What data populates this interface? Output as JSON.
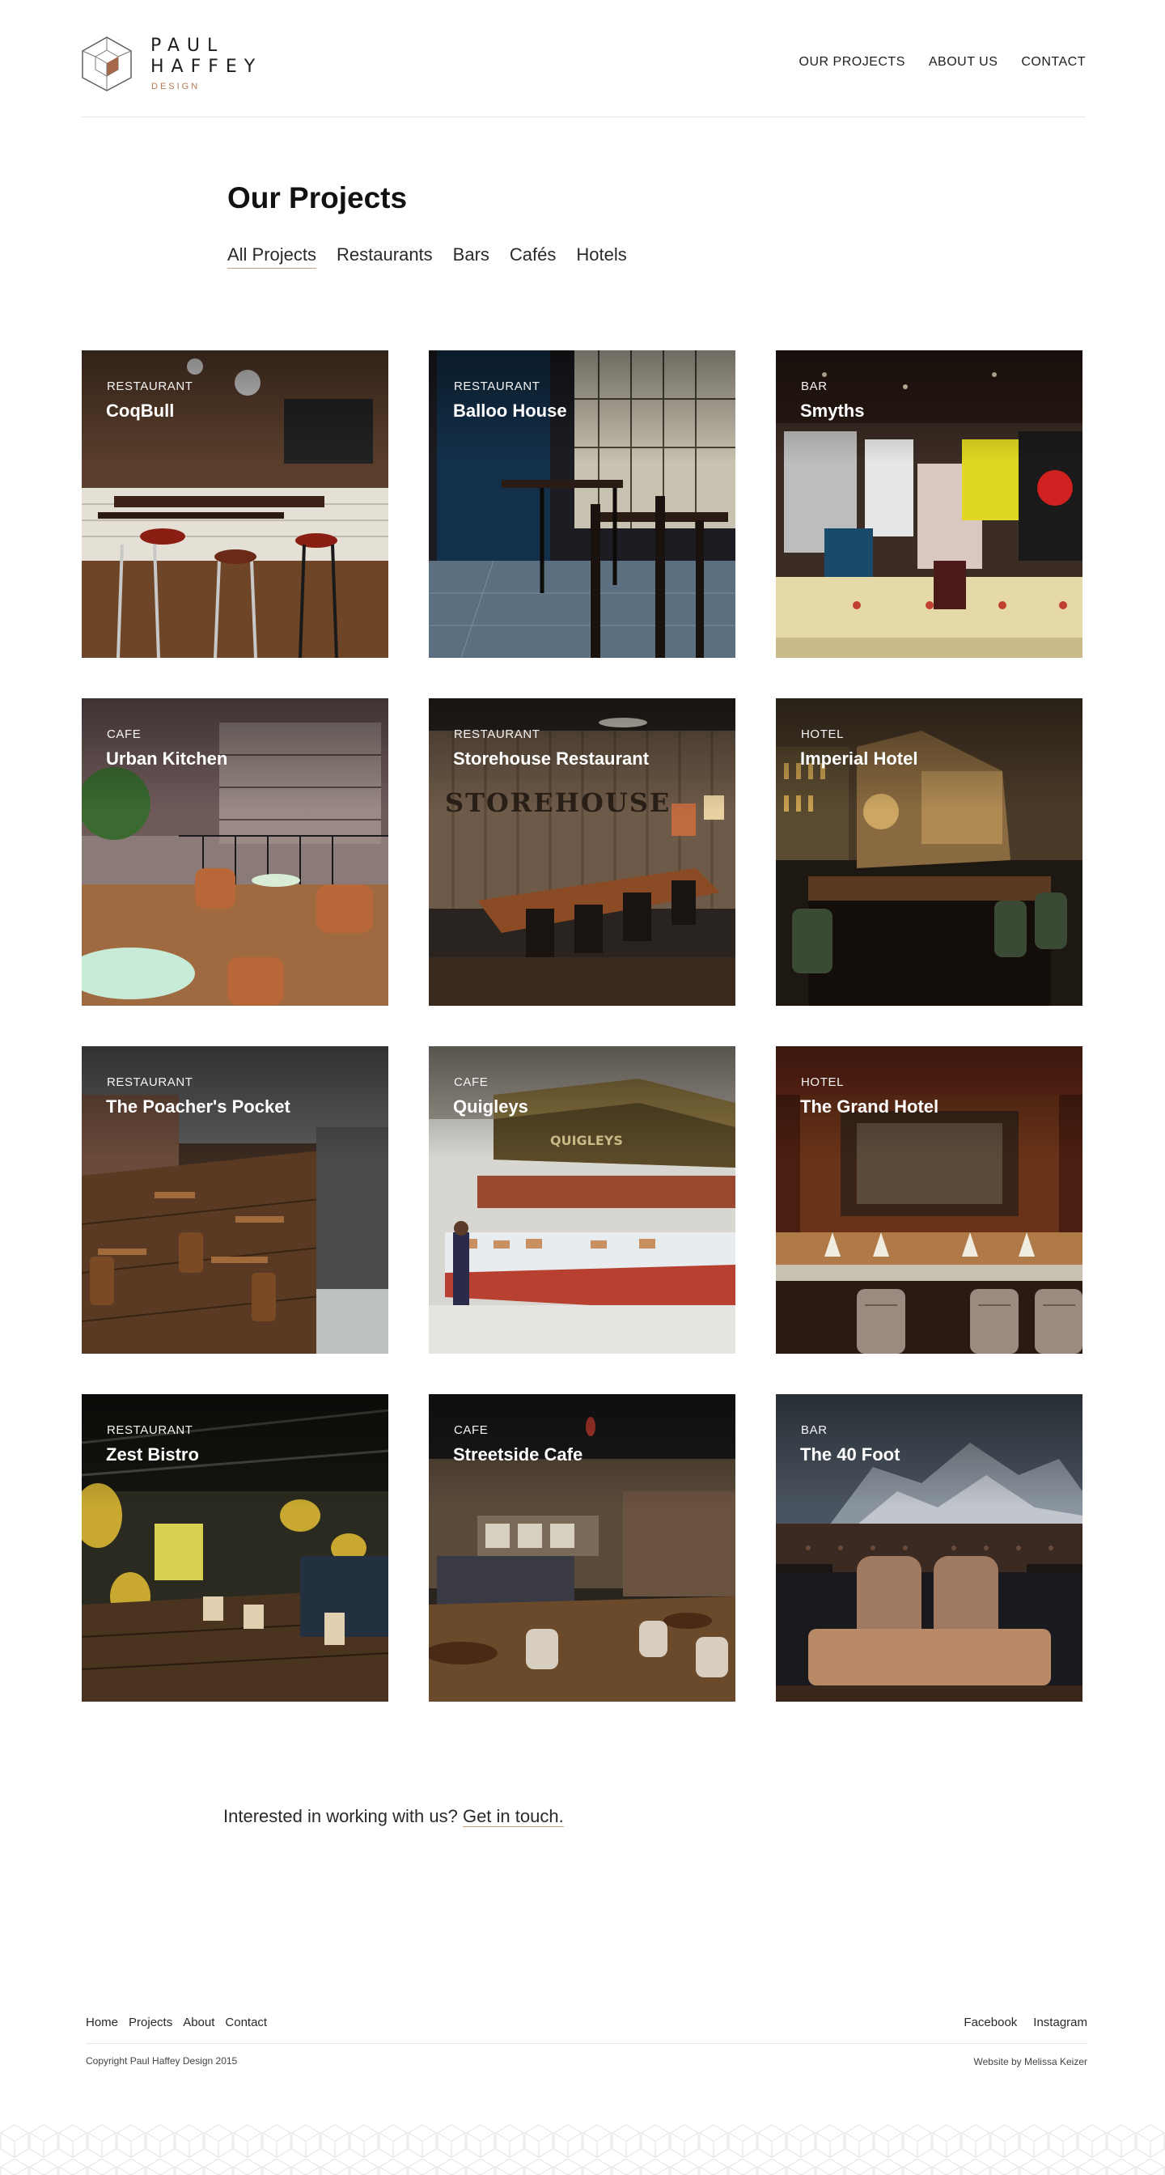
{
  "header": {
    "logo": {
      "line1": "PAUL",
      "line2": "HAFFEY",
      "sub": "DESIGN"
    },
    "nav": [
      {
        "label": "OUR PROJECTS"
      },
      {
        "label": "ABOUT US"
      },
      {
        "label": "CONTACT"
      }
    ]
  },
  "main": {
    "title": "Our Projects",
    "filters": [
      {
        "label": "All Projects",
        "active": true
      },
      {
        "label": "Restaurants"
      },
      {
        "label": "Bars"
      },
      {
        "label": "Cafés"
      },
      {
        "label": "Hotels"
      }
    ],
    "projects": [
      {
        "category": "RESTAURANT",
        "name": "CoqBull"
      },
      {
        "category": "RESTAURANT",
        "name": "Balloo House"
      },
      {
        "category": "BAR",
        "name": "Smyths"
      },
      {
        "category": "CAFE",
        "name": "Urban Kitchen"
      },
      {
        "category": "RESTAURANT",
        "name": "Storehouse Restaurant"
      },
      {
        "category": "HOTEL",
        "name": "Imperial Hotel"
      },
      {
        "category": "RESTAURANT",
        "name": "The Poacher's Pocket"
      },
      {
        "category": "CAFE",
        "name": "Quigleys"
      },
      {
        "category": "HOTEL",
        "name": "The Grand Hotel"
      },
      {
        "category": "RESTAURANT",
        "name": "Zest Bistro"
      },
      {
        "category": "CAFE",
        "name": "Streetside Cafe"
      },
      {
        "category": "BAR",
        "name": "The 40 Foot"
      }
    ],
    "cta": {
      "text": "Interested in working with us?",
      "link": "Get in touch."
    }
  },
  "footer": {
    "links": [
      {
        "label": "Home"
      },
      {
        "label": "Projects"
      },
      {
        "label": "About"
      },
      {
        "label": "Contact"
      }
    ],
    "social": [
      {
        "label": "Facebook"
      },
      {
        "label": "Instagram"
      }
    ],
    "copyright": "Copyright Paul Haffey Design 2015",
    "credit": "Website by Melissa Keizer"
  },
  "colors": {
    "accent": "#b07a56",
    "underline": "#c9a07c",
    "text": "#1e1e1e"
  }
}
